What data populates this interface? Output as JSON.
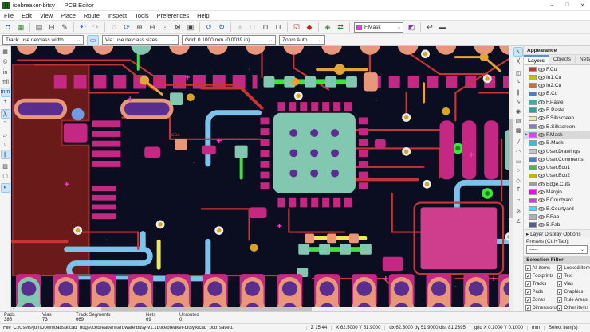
{
  "window": {
    "title": "icebreaker-bitsy — PCB Editor",
    "minimize": "–",
    "maximize": "□",
    "close": "✕"
  },
  "menubar": {
    "items": [
      "File",
      "Edit",
      "View",
      "Place",
      "Route",
      "Inspect",
      "Tools",
      "Preferences",
      "Help"
    ]
  },
  "toolbar_main": {
    "buttons": [
      {
        "name": "save",
        "glyph": "◘"
      },
      {
        "name": "board-setup",
        "glyph": "▦"
      },
      {
        "name": "page-settings",
        "glyph": "▤"
      },
      {
        "name": "print",
        "glyph": "⊟"
      },
      {
        "name": "plot",
        "glyph": "✎"
      },
      {
        "name": "undo",
        "glyph": "↶"
      },
      {
        "name": "redo",
        "glyph": "↷",
        "disabled": true
      },
      {
        "name": "find",
        "glyph": "◌"
      },
      {
        "name": "refresh",
        "glyph": "⟳"
      },
      {
        "name": "zoom-in",
        "glyph": "⊕"
      },
      {
        "name": "zoom-out",
        "glyph": "⊖"
      },
      {
        "name": "zoom-fit",
        "glyph": "⊡"
      },
      {
        "name": "zoom-selection",
        "glyph": "⊠"
      },
      {
        "name": "zoom-objects",
        "glyph": "▣"
      },
      {
        "name": "rotate-ccw",
        "glyph": "↺"
      },
      {
        "name": "rotate-cw",
        "glyph": "↻"
      },
      {
        "name": "group",
        "glyph": "⊞",
        "disabled": true
      },
      {
        "name": "ungroup",
        "glyph": "□",
        "disabled": true
      },
      {
        "name": "lock",
        "glyph": "⊓"
      },
      {
        "name": "unlock",
        "glyph": "⊔"
      },
      {
        "name": "design-rules-check",
        "glyph": "☑"
      },
      {
        "name": "inspect-clearance",
        "glyph": "◆"
      },
      {
        "name": "footprint-editor",
        "glyph": "◈"
      },
      {
        "name": "update-footprints",
        "glyph": "⇄"
      },
      {
        "name": "swap-layer-pair",
        "glyph": "◩"
      },
      {
        "name": "flip-board-view",
        "glyph": "↩"
      },
      {
        "name": "scripting-console",
        "glyph": "▬"
      }
    ],
    "layer_selector": {
      "value": "F.Mask",
      "swatch": "#E83DE8"
    }
  },
  "toolbar_settings": {
    "track_width": "Track: use netclass width",
    "auto_track_width_glyph": "▭",
    "via_size": "Via: use netclass sizes",
    "grid": "Grid: 0.1000 mm (0.0039 in)",
    "zoom": "Zoom Auto",
    "dropdown_arrow": "⌄"
  },
  "left_toolbar": {
    "buttons": [
      {
        "name": "toggle-grid",
        "glyph": "▦"
      },
      {
        "name": "polar-coordinates",
        "glyph": "◎"
      },
      {
        "name": "units-inches",
        "glyph": "in"
      },
      {
        "name": "units-mils",
        "glyph": "mil"
      },
      {
        "name": "units-mm",
        "glyph": "mm",
        "active": true
      },
      {
        "name": "crosshair-cursor",
        "glyph": "+"
      },
      {
        "name": "show-ratsnest",
        "glyph": "╳",
        "active": true
      },
      {
        "name": "curved-ratsnest",
        "glyph": "≈"
      },
      {
        "name": "sketch-pads",
        "glyph": "▱"
      },
      {
        "name": "sketch-vias",
        "glyph": "○"
      },
      {
        "name": "sketch-tracks",
        "glyph": "∥",
        "active": true
      },
      {
        "name": "zone-display-filled",
        "glyph": "▨"
      },
      {
        "name": "zone-display-outline",
        "glyph": "▢"
      },
      {
        "name": "dim-inactive-layers",
        "glyph": "◐",
        "active": true
      }
    ]
  },
  "right_toolbar": {
    "buttons": [
      {
        "name": "select-tool",
        "glyph": "↖",
        "active": true
      },
      {
        "name": "local-ratsnest",
        "glyph": "╳"
      },
      {
        "name": "add-footprint",
        "glyph": "◫"
      },
      {
        "name": "route-tracks",
        "glyph": "╰"
      },
      {
        "name": "route-differential-pair",
        "glyph": "∥"
      },
      {
        "name": "tune-track-length",
        "glyph": "∿"
      },
      {
        "name": "add-via",
        "glyph": "◉"
      },
      {
        "name": "add-filled-zone",
        "glyph": "▧"
      },
      {
        "name": "add-rule-area",
        "glyph": "▩"
      },
      {
        "name": "add-line",
        "glyph": "╱"
      },
      {
        "name": "add-arc",
        "glyph": "◠"
      },
      {
        "name": "add-rectangle",
        "glyph": "▭"
      },
      {
        "name": "add-circle",
        "glyph": "○"
      },
      {
        "name": "add-polygon",
        "glyph": "◇"
      },
      {
        "name": "add-text",
        "glyph": "T"
      },
      {
        "name": "add-dimension",
        "glyph": "↔"
      },
      {
        "name": "delete-items",
        "glyph": "⊘"
      },
      {
        "name": "measure-tool",
        "glyph": "∠"
      }
    ]
  },
  "appearance": {
    "title": "Appearance",
    "tabs": [
      "Layers",
      "Objects",
      "Nets"
    ],
    "active_tab": "Layers",
    "active_layer": "F.Mask",
    "layers": [
      {
        "name": "F.Cu",
        "color": "#C83434",
        "visible": true
      },
      {
        "name": "In1.Cu",
        "color": "#C2C200",
        "visible": true
      },
      {
        "name": "In2.Cu",
        "color": "#C87137",
        "visible": true
      },
      {
        "name": "B.Cu",
        "color": "#4D7FC4",
        "visible": true
      },
      {
        "name": "F.Paste",
        "color": "#3FAE9C",
        "visible": true
      },
      {
        "name": "B.Paste",
        "color": "#2F9F9F",
        "visible": true
      },
      {
        "name": "F.Silkscreen",
        "color": "#F0E6A8",
        "visible": true
      },
      {
        "name": "B.Silkscreen",
        "color": "#8B7BC8",
        "visible": true
      },
      {
        "name": "F.Mask",
        "color": "#E83DE8",
        "visible": true,
        "active": true
      },
      {
        "name": "B.Mask",
        "color": "#26C6DA",
        "visible": true
      },
      {
        "name": "User.Drawings",
        "color": "#C5C5C5",
        "visible": true
      },
      {
        "name": "User.Comments",
        "color": "#4E7FBE",
        "visible": true
      },
      {
        "name": "User.Eco1",
        "color": "#53B253",
        "visible": true
      },
      {
        "name": "User.Eco2",
        "color": "#C8B400",
        "visible": true
      },
      {
        "name": "Edge.Cuts",
        "color": "#9E9E9E",
        "visible": true
      },
      {
        "name": "Margin",
        "color": "#FF00FF",
        "visible": true
      },
      {
        "name": "F.Courtyard",
        "color": "#FF26E2",
        "visible": true
      },
      {
        "name": "B.Courtyard",
        "color": "#26E9FF",
        "visible": true
      },
      {
        "name": "F.Fab",
        "color": "#AFAFAF",
        "visible": true
      },
      {
        "name": "B.Fab",
        "color": "#585D84",
        "visible": true
      }
    ],
    "active_arrow": "▶",
    "layer_display_options": "▸ Layer Display Options",
    "presets_label": "Presets (Ctrl+Tab):",
    "presets_value": "-----"
  },
  "selection_filter": {
    "title": "Selection Filter",
    "items": [
      {
        "label": "All items",
        "checked": true
      },
      {
        "label": "Locked items",
        "checked": true
      },
      {
        "label": "Footprints",
        "checked": true
      },
      {
        "label": "Text",
        "checked": true
      },
      {
        "label": "Tracks",
        "checked": true
      },
      {
        "label": "Vias",
        "checked": true
      },
      {
        "label": "Pads",
        "checked": true
      },
      {
        "label": "Graphics",
        "checked": true
      },
      {
        "label": "Zones",
        "checked": true
      },
      {
        "label": "Rule Areas",
        "checked": true
      },
      {
        "label": "Dimensions",
        "checked": true
      },
      {
        "label": "Other items",
        "checked": true
      }
    ]
  },
  "stats": [
    {
      "label": "Pads",
      "value": "385"
    },
    {
      "label": "Vias",
      "value": "73"
    },
    {
      "label": "Track Segments",
      "value": "669"
    },
    {
      "label": "Nets",
      "value": "69"
    },
    {
      "label": "Unrouted",
      "value": "0"
    }
  ],
  "statusbar": {
    "message": "File 'C:\\Users\\jon\\Downloads\\kicad_bugs\\icebreaker\\hardware\\bitsy-v1.1b\\icebreaker-bitsy.kicad_pcb' saved.",
    "zoom": "Z 15.44",
    "cursor": "X 62.5000 Y 51.9000",
    "delta": "dx 62.5000  dy 51.9000  dist 81.2395",
    "grid": "grid X 0.1000  Y 0.1000",
    "units": "mm",
    "action": "Select item(s)"
  },
  "canvas": {
    "reference_label": "CC1",
    "colors": {
      "board_bg": "#0B0E20",
      "pour": "#6B1A1A",
      "copper_front": "#C83434",
      "copper_back": "#7CC3EC",
      "pad_mask": "#C42882",
      "pad_exposed": "#82C7AF",
      "silk_pad": "#E8977B",
      "drill": "#5B2D8E",
      "via_ring": "#ECECEC",
      "via_hole": "#D9A420",
      "trace_orange": "#E2A636",
      "trace_green": "#3FE23F",
      "trace_yellow": "#EDE75A",
      "mask_marker": "#FF35C8",
      "big_pad": "#CE3E8C",
      "via_blue": "#6F9BE0"
    }
  }
}
